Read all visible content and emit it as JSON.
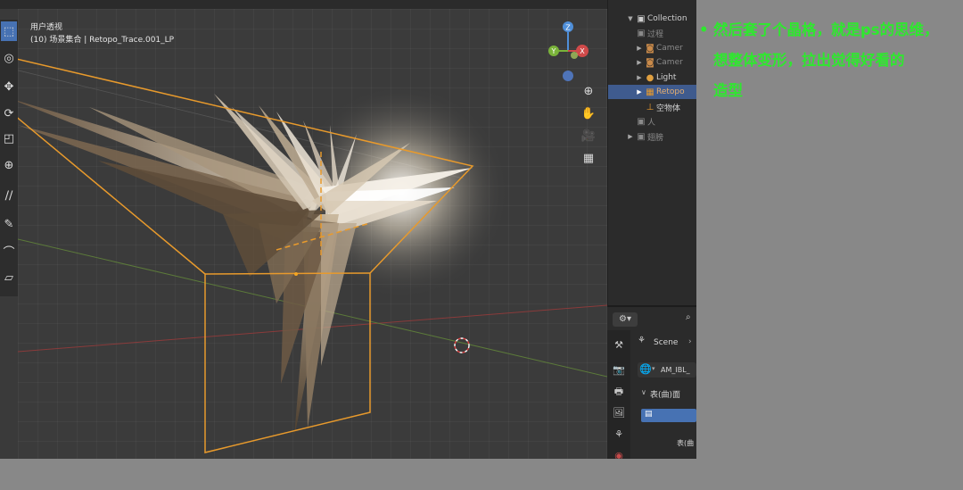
{
  "viewport": {
    "view_name": "用户透视",
    "context_line": "(10) 场景集合 | Retopo_Trace.001_LP"
  },
  "gizmo": {
    "z_label": "Z",
    "x_label": "X",
    "y_label": "Y"
  },
  "outliner": {
    "items": [
      {
        "label": "Collection"
      },
      {
        "label": "过程"
      },
      {
        "label": "Camer"
      },
      {
        "label": "Camer"
      },
      {
        "label": "Light"
      },
      {
        "label": "Retopo"
      },
      {
        "label": "空物体"
      },
      {
        "label": "人"
      },
      {
        "label": "翅膀"
      }
    ]
  },
  "properties": {
    "scene_label": "Scene",
    "world_field": "AM_IBL_",
    "section_label": "表(曲)面",
    "field_label": "表(曲"
  },
  "caption": {
    "bullet": "•",
    "lines": [
      "然后套了个晶格，就是ps的思维，",
      "想整体变形，拉出觉得好看的",
      "造型"
    ]
  },
  "colors": {
    "accent_blue": "#4772b3",
    "caption_green": "#2ee82e",
    "lattice_orange": "#e89a2c"
  }
}
